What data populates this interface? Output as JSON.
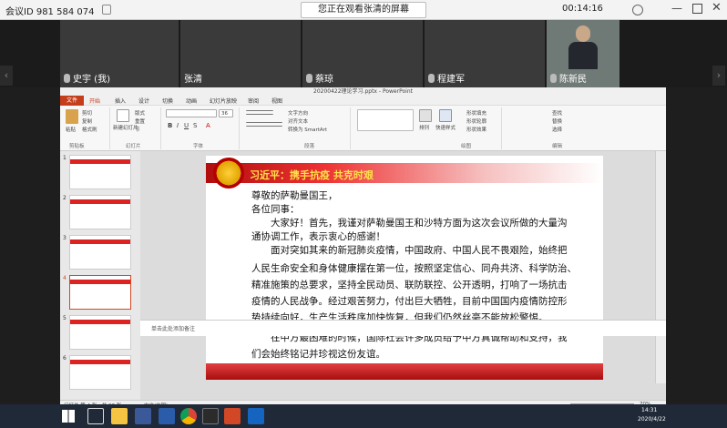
{
  "meeting": {
    "id_label": "会议ID 981 584 074",
    "watching": "您正在观看张清的屏幕",
    "timer": "00:14:16"
  },
  "participants": [
    {
      "name": "史宇 (我)"
    },
    {
      "name": "张清"
    },
    {
      "name": "蔡琼"
    },
    {
      "name": "程建军"
    },
    {
      "name": "陈新民"
    }
  ],
  "ppt": {
    "window_title": "20200422理论学习.pptx - PowerPoint",
    "tabs": [
      "文件",
      "开始",
      "插入",
      "设计",
      "切换",
      "动画",
      "幻灯片放映",
      "审阅",
      "视图"
    ],
    "selected_tab": "开始",
    "ribbon": {
      "paste": "粘贴",
      "cut": "剪切",
      "copy": "复制",
      "format_painter": "格式刷",
      "new_slide": "新建幻灯片",
      "layout": "版式",
      "reset": "重置",
      "section": "节",
      "font_size": "36",
      "text_direction": "文字方向",
      "align_text": "对齐文本",
      "smartart": "转换为 SmartArt",
      "arrange": "排列",
      "quick_styles": "快速样式",
      "shape_fill": "形状填充",
      "shape_outline": "形状轮廓",
      "shape_effects": "形状效果",
      "find": "查找",
      "replace": "替换",
      "select": "选择",
      "groups": [
        "剪贴板",
        "幻灯片",
        "字体",
        "段落",
        "绘图",
        "编辑"
      ]
    },
    "slide_numbers": [
      "1",
      "2",
      "3",
      "4",
      "5",
      "6"
    ],
    "slide": {
      "title": "习近平：携手抗疫 共克时艰",
      "lines": [
        "尊敬的萨勒曼国王，",
        "各位同事：",
        "　　大家好！首先，我谨对萨勒曼国王和沙特方面为这次会议所做的大量沟",
        "通协调工作，表示衷心的感谢！",
        "　　面对突如其来的新冠肺炎疫情，中国政府、中国人民不畏艰险，始终把",
        "人民生命安全和身体健康摆在第一位，按照坚定信心、同舟共济、科学防治、",
        "精准施策的总要求，坚持全民动员、联防联控、公开透明，打响了一场抗击",
        "疫情的人民战争。经过艰苦努力，付出巨大牺牲，目前中国国内疫情防控形",
        "势持续向好，生产生活秩序加快恢复，但我们仍然丝毫不能放松警惕。",
        "　　在中方最困难的时候，国际社会许多成员给予中方真诚帮助和支持，我",
        "们会始终铭记并珍视这份友谊。"
      ]
    },
    "notes_placeholder": "单击此处添加备注",
    "status": {
      "slide_info": "幻灯片 第 4 张，共 23 张",
      "language": "中文(中国)",
      "zoom": "70%"
    }
  },
  "taskbar": {
    "time": "14:31",
    "date": "2020/4/22"
  },
  "colors": {
    "ppt_accent": "#c43e1c",
    "slide_red": "#b10d0d",
    "title_yellow": "#ffe24a"
  }
}
